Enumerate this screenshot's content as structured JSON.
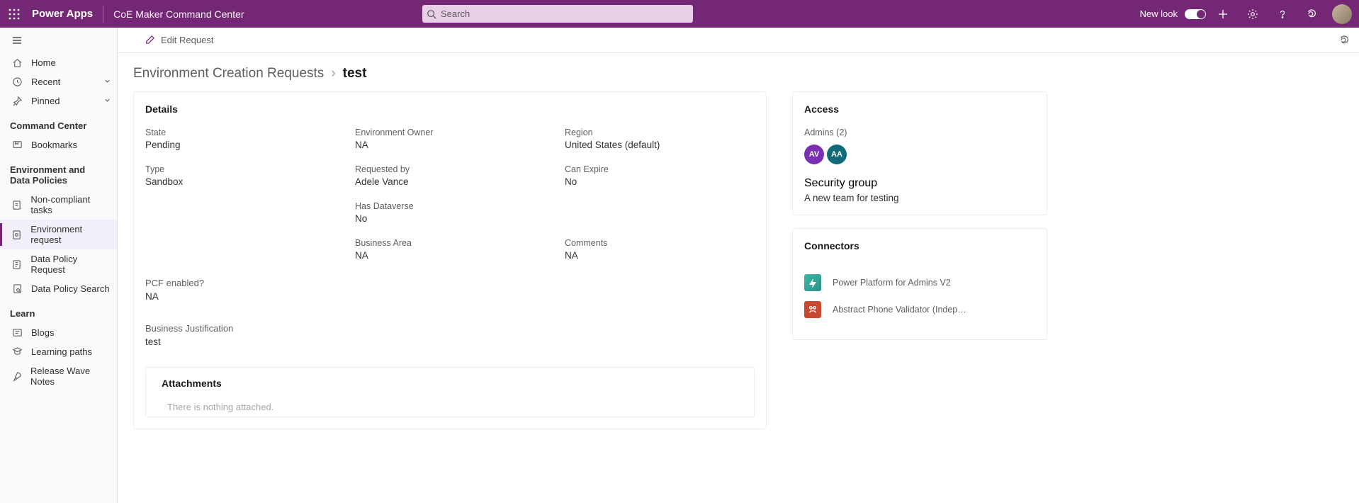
{
  "header": {
    "brand": "Power Apps",
    "appTitle": "CoE Maker Command Center",
    "searchPlaceholder": "Search",
    "newLook": "New look"
  },
  "sidebar": {
    "nav": [
      {
        "icon": "home",
        "label": "Home"
      },
      {
        "icon": "clock",
        "label": "Recent",
        "chevron": true
      },
      {
        "icon": "pin",
        "label": "Pinned",
        "chevron": true
      }
    ],
    "sections": [
      {
        "title": "Command Center",
        "items": [
          {
            "icon": "bookmark",
            "label": "Bookmarks"
          }
        ]
      },
      {
        "title": "Environment and Data Policies",
        "items": [
          {
            "icon": "task",
            "label": "Non-compliant tasks"
          },
          {
            "icon": "env",
            "label": "Environment request",
            "selected": true
          },
          {
            "icon": "policy",
            "label": "Data Policy Request"
          },
          {
            "icon": "search",
            "label": "Data Policy Search"
          }
        ]
      },
      {
        "title": "Learn",
        "items": [
          {
            "icon": "blog",
            "label": "Blogs"
          },
          {
            "icon": "learn",
            "label": "Learning paths"
          },
          {
            "icon": "rocket",
            "label": "Release Wave Notes"
          }
        ]
      }
    ]
  },
  "cmdbar": {
    "edit": "Edit Request"
  },
  "crumb": {
    "parent": "Environment Creation Requests",
    "current": "test"
  },
  "details": {
    "title": "Details",
    "fields": {
      "state": {
        "label": "State",
        "value": "Pending"
      },
      "envOwner": {
        "label": "Environment Owner",
        "value": "NA"
      },
      "region": {
        "label": "Region",
        "value": "United States (default)"
      },
      "type": {
        "label": "Type",
        "value": "Sandbox"
      },
      "requestedBy": {
        "label": "Requested by",
        "value": "Adele Vance"
      },
      "canExpire": {
        "label": "Can Expire",
        "value": "No"
      },
      "hasDataverse": {
        "label": "Has Dataverse",
        "value": "No"
      },
      "businessArea": {
        "label": "Business Area",
        "value": "NA"
      },
      "comments": {
        "label": "Comments",
        "value": "NA"
      },
      "pcfEnabled": {
        "label": "PCF enabled?",
        "value": "NA"
      },
      "bizJust": {
        "label": "Business Justification",
        "value": "test"
      }
    }
  },
  "attachments": {
    "title": "Attachments",
    "empty": "There is nothing attached."
  },
  "access": {
    "title": "Access",
    "adminsLabel": "Admins (2)",
    "admins": [
      "AV",
      "AA"
    ],
    "securityGroupLabel": "Security group",
    "securityGroup": "A new team for testing"
  },
  "connectors": {
    "title": "Connectors",
    "items": [
      {
        "icon": "pp",
        "name": "Power Platform for Admins V2"
      },
      {
        "icon": "ab",
        "name": "Abstract Phone Validator (Indep…"
      }
    ]
  }
}
